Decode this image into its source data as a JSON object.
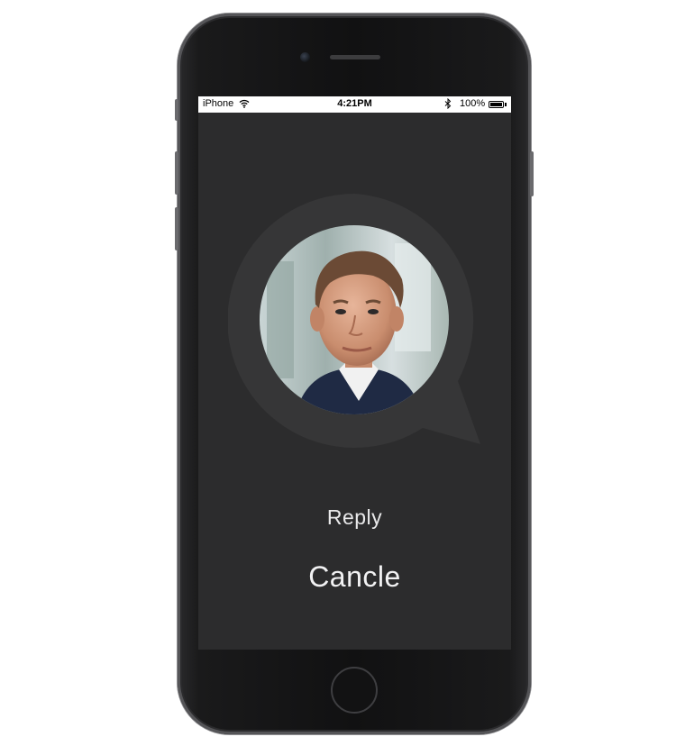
{
  "status_bar": {
    "carrier": "iPhone",
    "time": "4:21PM",
    "battery_percent": "100%",
    "battery_level": 1.0,
    "wifi_icon": "wifi-icon",
    "bluetooth_icon": "bluetooth-icon"
  },
  "call": {
    "contact_photo": "avatar",
    "reply_label": "Reply",
    "cancel_label": "Cancle"
  },
  "colors": {
    "screen_background": "#2c2c2d",
    "bubble": "#373738",
    "text": "#eeeeef"
  }
}
